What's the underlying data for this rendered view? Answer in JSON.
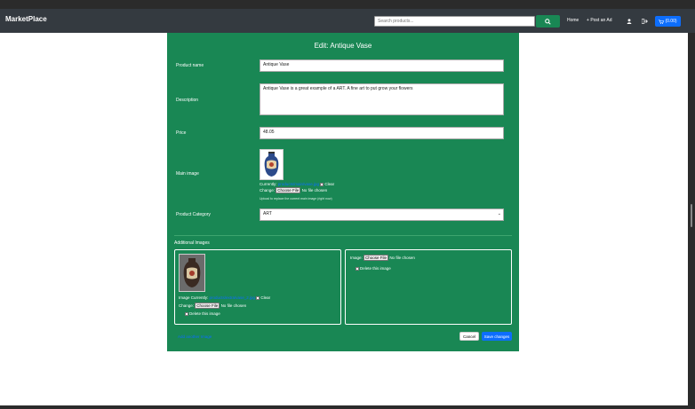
{
  "navbar": {
    "brand": "MarketPlace",
    "search_placeholder": "Search products...",
    "home": "Home",
    "post_ad": "Post an Ad",
    "cart_label": "(0.00)"
  },
  "form": {
    "title": "Edit: Antique Vase",
    "product_name_label": "Product name",
    "product_name_value": "Antique Vase",
    "description_label": "Description",
    "description_value": "Antique Vase is a great example of a ART. A fine art to put grow your flowers",
    "price_label": "Price",
    "price_value": "48.05",
    "main_image_label": "Main image",
    "currently_label": "Currently:",
    "currently_link": "products/main/vase.jpg",
    "clear_label": "Clear",
    "change_label": "Change:",
    "choose_file": "Choose File",
    "no_file": "No file chosen",
    "main_image_hint": "Upload to replace the current main image (right now)",
    "category_label": "Product Category",
    "category_value": "ART",
    "additional_images_title": "Additional Images",
    "image_currently_label": "Image Currently:",
    "additional_link": "products/extra/vase_2.jpg",
    "image_label": "Image:",
    "delete_image": "Delete this image",
    "add_image_link": "Add another Image",
    "cancel": "Cancel",
    "save": "Save changes"
  },
  "colors": {
    "navbar": "#343a40",
    "card": "#198754",
    "primary": "#0d6efd"
  }
}
